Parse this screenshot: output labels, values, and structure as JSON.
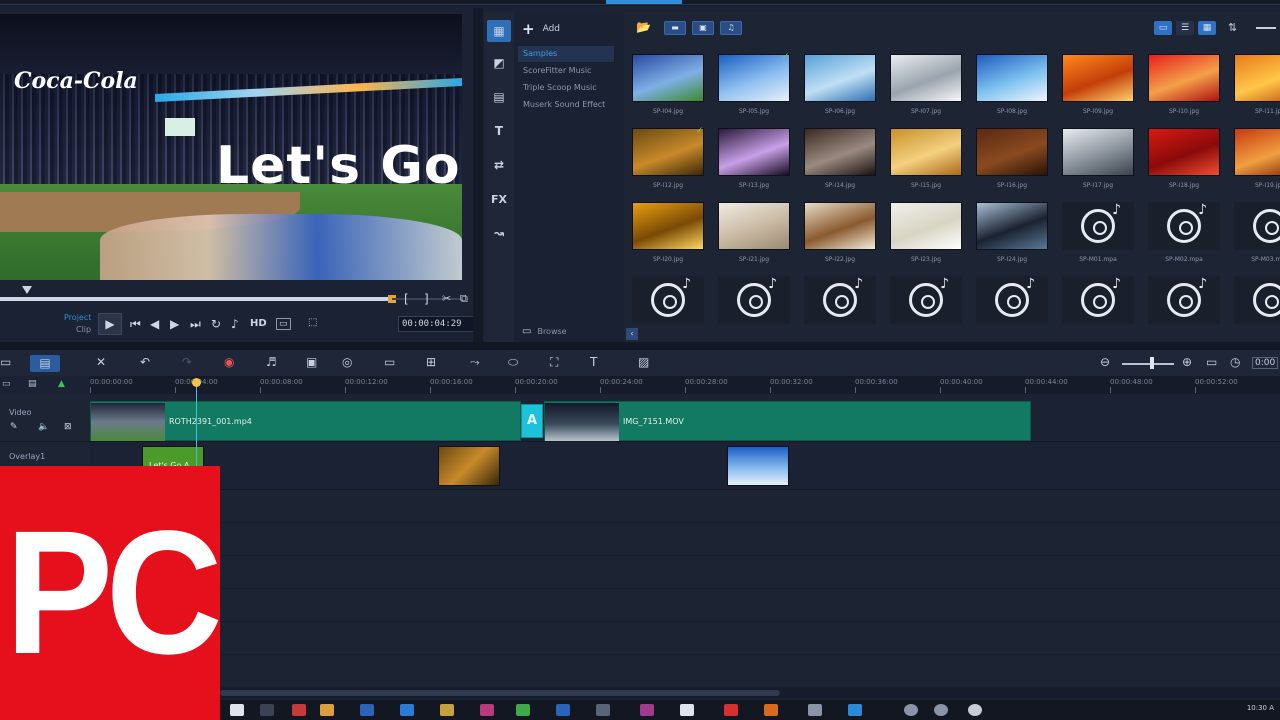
{
  "preview": {
    "logo_text": "Coca-Cola",
    "title_text": "Let's Go",
    "project_label": "Project",
    "clip_label": "Clip",
    "timecode": "00:00:04:29",
    "hd_label": "HD"
  },
  "side_tools": [
    "media",
    "instant-project",
    "template",
    "title",
    "transition",
    "filter",
    "path"
  ],
  "side_tool_labels": {
    "title": "T",
    "fx": "FX"
  },
  "library_nav": {
    "add_label": "Add",
    "items": [
      "Samples",
      "ScoreFitter Music",
      "Triple Scoop Music",
      "Muserk Sound Effect"
    ],
    "browse_label": "Browse"
  },
  "library": {
    "rows": [
      [
        {
          "label": "SP-I04.jpg",
          "colors": [
            "#2a4aa0",
            "#7fb0e6",
            "#3c8a2e"
          ]
        },
        {
          "label": "SP-I05.jpg",
          "colors": [
            "#1a5fc4",
            "#8fc0f0",
            "#e8f0f8"
          ],
          "checked": true
        },
        {
          "label": "SP-I06.jpg",
          "colors": [
            "#5aa0d8",
            "#bfe0f4",
            "#2d6fb0"
          ]
        },
        {
          "label": "SP-I07.jpg",
          "colors": [
            "#e8ecf0",
            "#9aa4ae",
            "#f8f8f8"
          ]
        },
        {
          "label": "SP-I08.jpg",
          "colors": [
            "#1e5bbf",
            "#7ec2f0",
            "#f0f6fc"
          ]
        },
        {
          "label": "SP-I09.jpg",
          "colors": [
            "#ff8a1a",
            "#c33e0a",
            "#ffd16a"
          ]
        },
        {
          "label": "SP-I10.jpg",
          "colors": [
            "#e8201c",
            "#f4a04a",
            "#b01010"
          ]
        },
        {
          "label": "SP-I11.jpg",
          "colors": [
            "#e87a1a",
            "#ffc84a",
            "#c04a0a"
          ]
        }
      ],
      [
        {
          "label": "SP-I12.jpg",
          "colors": [
            "#6a4a10",
            "#c88a2a",
            "#3a2808"
          ],
          "checked": true
        },
        {
          "label": "SP-I13.jpg",
          "colors": [
            "#2a1a3a",
            "#c8a0e8",
            "#140a1e"
          ]
        },
        {
          "label": "SP-I14.jpg",
          "colors": [
            "#3a2a24",
            "#9a8a80",
            "#1a120e"
          ]
        },
        {
          "label": "SP-I15.jpg",
          "colors": [
            "#c8902a",
            "#f4d080",
            "#a86a1a"
          ]
        },
        {
          "label": "SP-I16.jpg",
          "colors": [
            "#5a2a10",
            "#8a4a20",
            "#2a1206"
          ]
        },
        {
          "label": "SP-I17.jpg",
          "colors": [
            "#e8ecf0",
            "#8a929c",
            "#3a424c"
          ]
        },
        {
          "label": "SP-I18.jpg",
          "colors": [
            "#d81a14",
            "#8a0a0a",
            "#f05030"
          ]
        },
        {
          "label": "SP-I19.jpg",
          "colors": [
            "#c83a10",
            "#f0a040",
            "#7a1a08"
          ]
        }
      ],
      [
        {
          "label": "SP-I20.jpg",
          "colors": [
            "#e8a010",
            "#7a4a06",
            "#ffd860"
          ]
        },
        {
          "label": "SP-I21.jpg",
          "colors": [
            "#f0ece4",
            "#c8b8a0",
            "#9a8a74"
          ]
        },
        {
          "label": "SP-I22.jpg",
          "colors": [
            "#e8dcc4",
            "#8a5a30",
            "#f4ecd8"
          ]
        },
        {
          "label": "SP-I23.jpg",
          "colors": [
            "#f0f0ea",
            "#d8d4c4",
            "#ffffff"
          ]
        },
        {
          "label": "SP-I24.jpg",
          "colors": [
            "#a8c0d8",
            "#1a2230",
            "#5a7a98"
          ]
        },
        {
          "label": "SP-M01.mpa",
          "music": true
        },
        {
          "label": "SP-M02.mpa",
          "music": true
        },
        {
          "label": "SP-M03.mpa",
          "music": true
        }
      ],
      [
        {
          "label": "",
          "music": true
        },
        {
          "label": "",
          "music": true
        },
        {
          "label": "",
          "music": true
        },
        {
          "label": "",
          "music": true
        },
        {
          "label": "",
          "music": true
        },
        {
          "label": "",
          "music": true
        },
        {
          "label": "",
          "music": true
        },
        {
          "label": "",
          "music": true
        }
      ]
    ]
  },
  "timeline": {
    "ruler": [
      "00:00:00:00",
      "00:00:04:00",
      "00:00:08:00",
      "00:00:12:00",
      "00:00:16:00",
      "00:00:20:00",
      "00:00:24:00",
      "00:00:28:00",
      "00:00:32:00",
      "00:00:36:00",
      "00:00:40:00",
      "00:00:44:00",
      "00:00:48:00",
      "00:00:52:00"
    ],
    "tracks": {
      "video": "Video",
      "overlay": "Overlay1"
    },
    "clips": {
      "clip1": "ROTH2391_001.mp4",
      "clip2": "IMG_7151.MOV",
      "transition": "A",
      "title_clip": "Let's Go A"
    },
    "zoom_time": "0:00"
  },
  "taskbar": {
    "clock": "10:30 A"
  },
  "overlay_logo": {
    "text": "PC",
    "color": "#e5101b"
  }
}
